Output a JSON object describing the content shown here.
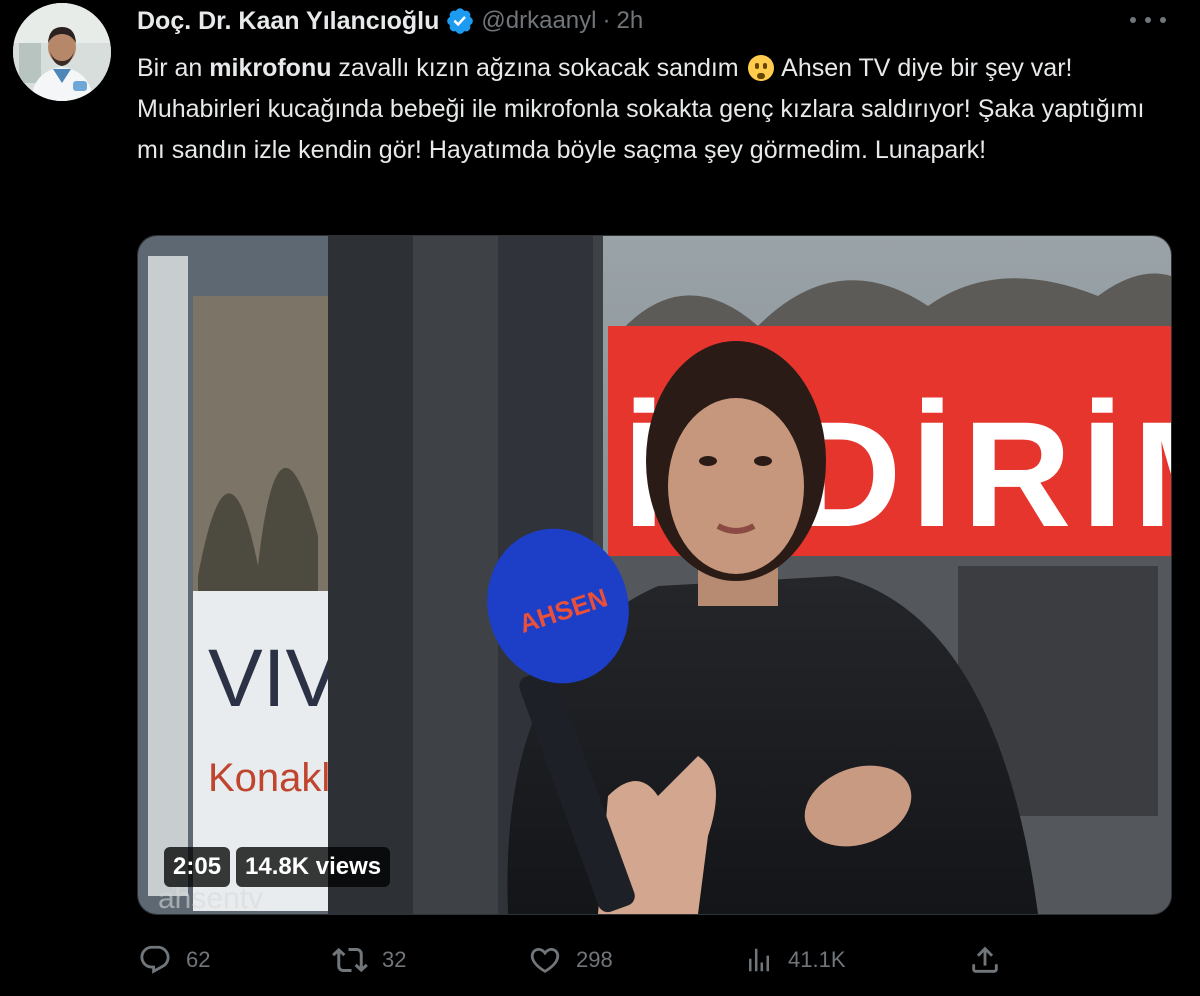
{
  "post": {
    "author_name": "Doç. Dr. Kaan Yılancıoğlu",
    "handle": "@drkaanyl",
    "separator": "·",
    "time": "2h",
    "text": {
      "part1": "Bir an ",
      "bold": "mikrofonu",
      "part2": " zavallı kızın ağzına sokacak sandım ",
      "part3": " Ahsen TV diye bir şey var! Muhabirleri kucağında bebeği ile mikrofonla sokakta genç kızlara saldırıyor! Şaka yaptığımı mı sandın izle kendin gör! Hayatımda böyle saçma şey görmedim. Lunapark!"
    },
    "emoji": "shushing-face-emoji"
  },
  "video": {
    "duration": "2:05",
    "views": "14.8K views",
    "signage": {
      "store_banner": "İNDİRİM",
      "shop_sign": "VIV",
      "shop_sign_sub": "Konaklı",
      "watermark": "ahsentv"
    }
  },
  "actions": {
    "replies": "62",
    "retweets": "32",
    "likes": "298",
    "views": "41.1K"
  },
  "colors": {
    "background": "#000000",
    "text_primary": "#e7e9ea",
    "text_secondary": "#71767b",
    "verified": "#1d9bf0",
    "banner_red": "#e6352d"
  },
  "icons": [
    "verified-badge-icon",
    "more-icon",
    "reply-icon",
    "retweet-icon",
    "like-icon",
    "analytics-icon",
    "share-icon"
  ]
}
